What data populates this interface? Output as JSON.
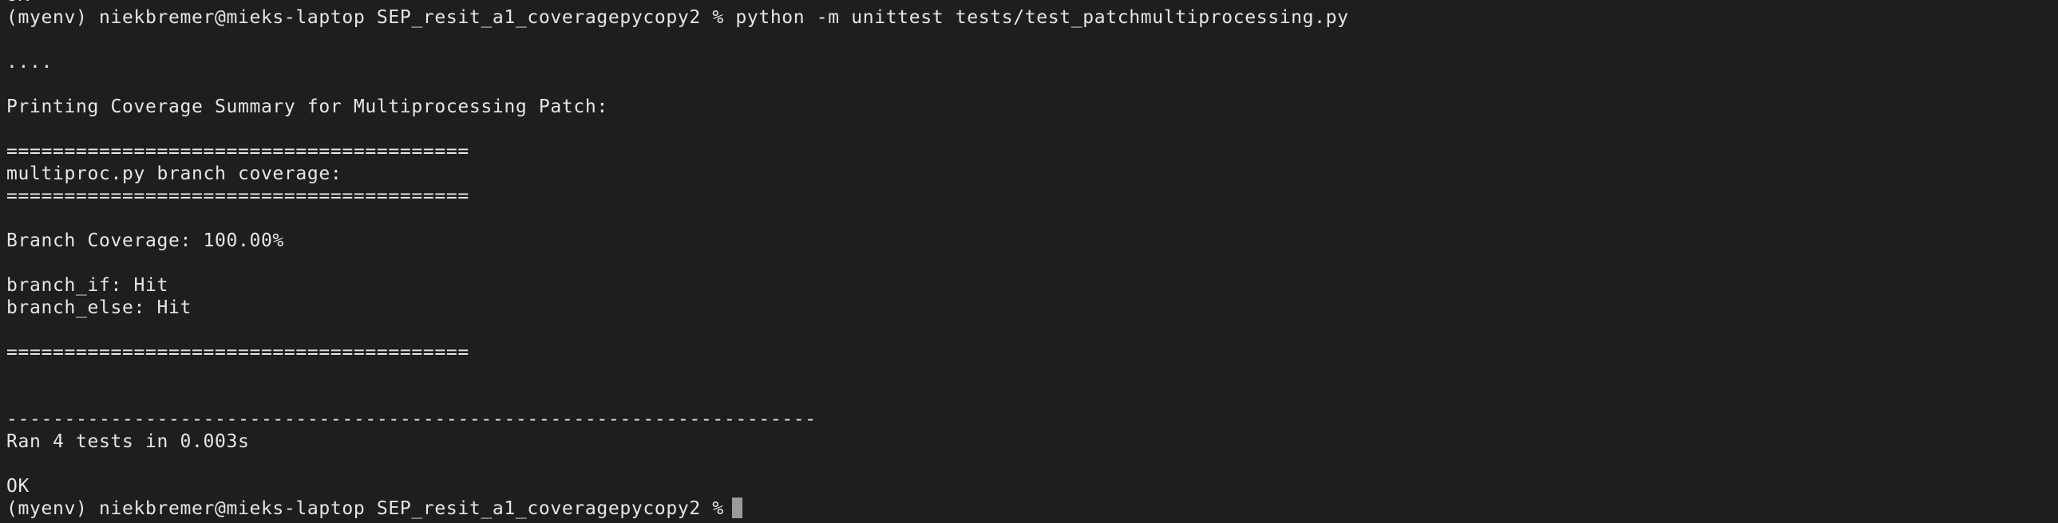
{
  "terminal": {
    "partial_top_line": "OK",
    "command_line": "(myenv) niekbremer@mieks-laptop SEP_resit_a1_coveragepycopy2 % python -m unittest tests/test_patchmultiprocessing.py",
    "progress_dots": "....",
    "summary_heading": "Printing Coverage Summary for Multiprocessing Patch:",
    "separator_eq_1": "========================================",
    "coverage_file_heading": "multiproc.py branch coverage:",
    "separator_eq_2": "========================================",
    "branch_coverage": "Branch Coverage: 100.00%",
    "branch_if": "branch_if: Hit",
    "branch_else": "branch_else: Hit",
    "separator_eq_3": "========================================",
    "separator_dash": "----------------------------------------------------------------------",
    "ran_tests": "Ran 4 tests in 0.003s",
    "result": "OK",
    "prompt": "(myenv) niekbremer@mieks-laptop SEP_resit_a1_coveragepycopy2 %"
  },
  "colors": {
    "background": "#1e1e1e",
    "foreground": "#e6e6e6",
    "cursor": "#9a9a9a"
  }
}
